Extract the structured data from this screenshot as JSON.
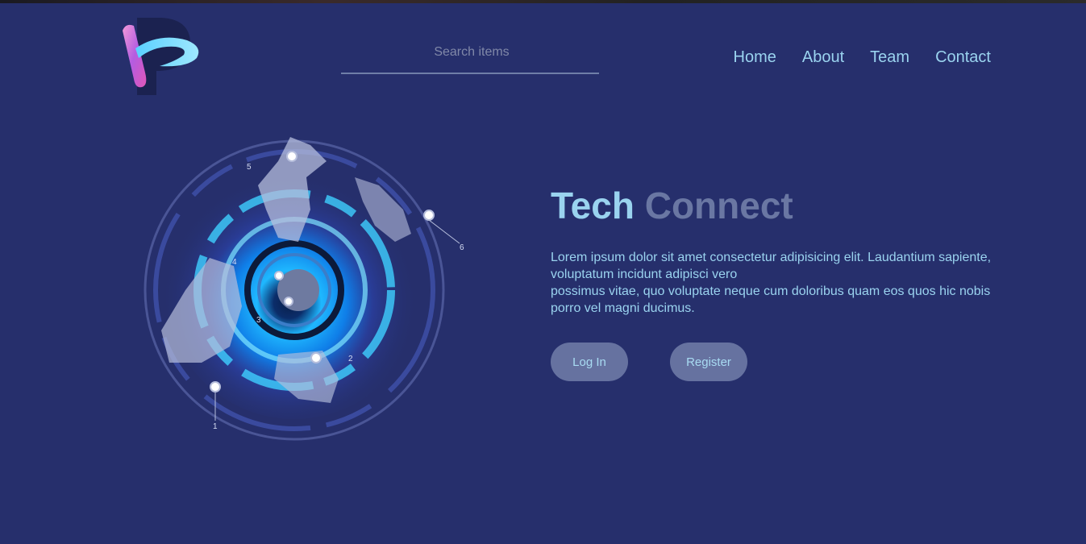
{
  "header": {
    "search": {
      "placeholder": "Search items",
      "value": ""
    },
    "nav": [
      {
        "label": "Home"
      },
      {
        "label": "About"
      },
      {
        "label": "Team"
      },
      {
        "label": "Contact"
      }
    ]
  },
  "hero": {
    "title_word1": "Tech",
    "title_word2": "Connect",
    "description_line1": "Lorem ipsum dolor sit amet consectetur adipisicing elit. Laudantium sapiente, voluptatum incidunt adipisci vero",
    "description_line2": "possimus vitae, quo voluptate neque cum doloribus quam eos quos hic nobis porro vel magni ducimus.",
    "login_label": "Log In",
    "register_label": "Register"
  },
  "globe": {
    "markers": [
      "1",
      "2",
      "3",
      "4",
      "5",
      "6"
    ]
  },
  "colors": {
    "background": "#262f6c",
    "accent": "#9ad3ef",
    "muted": "#6a77a3",
    "button": "#6672a0"
  }
}
